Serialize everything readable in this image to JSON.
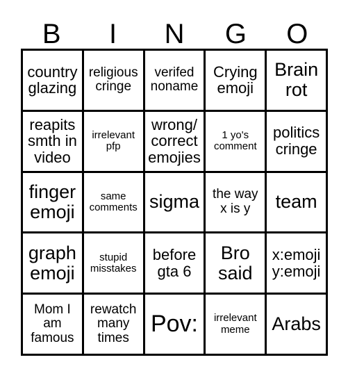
{
  "card": {
    "type": "bingo-card",
    "header_letters": [
      "B",
      "I",
      "N",
      "G",
      "O"
    ],
    "grid_size": "5x5",
    "colors": {
      "background": "#ffffff",
      "text": "#000000",
      "border": "#000000"
    },
    "cells": [
      {
        "text": "country glazing",
        "size": "md"
      },
      {
        "text": "religious cringe",
        "size": "sm"
      },
      {
        "text": "verifed noname",
        "size": "sm"
      },
      {
        "text": "Crying emoji",
        "size": "md"
      },
      {
        "text": "Brain rot",
        "size": "lg"
      },
      {
        "text": "reapits smth in video",
        "size": "md"
      },
      {
        "text": "irrelevant pfp",
        "size": "xs"
      },
      {
        "text": "wrong/ correct emojies",
        "size": "md"
      },
      {
        "text": "1 yo's comment",
        "size": "xs"
      },
      {
        "text": "politics cringe",
        "size": "md"
      },
      {
        "text": "finger emoji",
        "size": "lg"
      },
      {
        "text": "same comments",
        "size": "xs"
      },
      {
        "text": "sigma",
        "size": "lg"
      },
      {
        "text": "the way x is y",
        "size": "sm"
      },
      {
        "text": "team",
        "size": "lg"
      },
      {
        "text": "graph emoji",
        "size": "lg"
      },
      {
        "text": "stupid misstakes",
        "size": "xs"
      },
      {
        "text": "before gta 6",
        "size": "md"
      },
      {
        "text": "Bro said",
        "size": "lg"
      },
      {
        "text": "x:emoji y:emoji",
        "size": "md"
      },
      {
        "text": "Mom I am famous",
        "size": "sm"
      },
      {
        "text": "rewatch many times",
        "size": "sm"
      },
      {
        "text": "Pov:",
        "size": "xl"
      },
      {
        "text": "irrelevant meme",
        "size": "xs"
      },
      {
        "text": "Arabs",
        "size": "lg"
      }
    ]
  }
}
